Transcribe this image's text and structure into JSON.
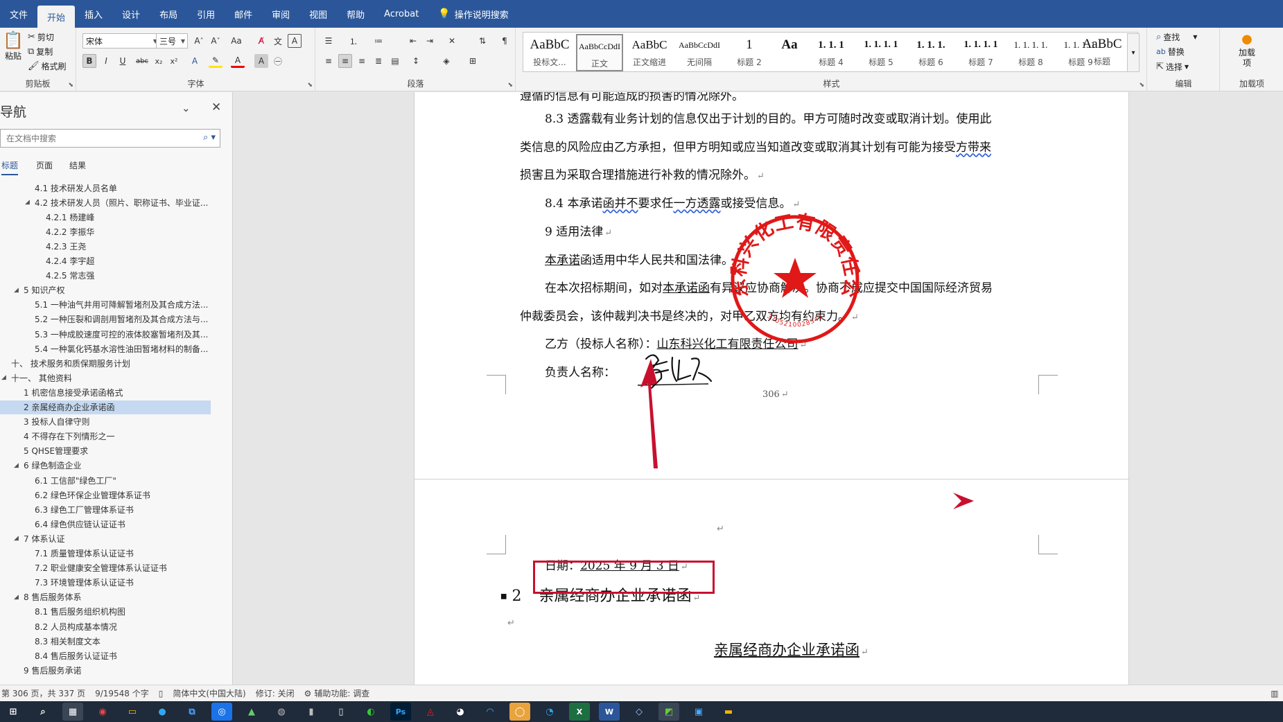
{
  "menu": {
    "tabs": [
      "文件",
      "开始",
      "插入",
      "设计",
      "布局",
      "引用",
      "邮件",
      "审阅",
      "视图",
      "帮助",
      "Acrobat"
    ],
    "active": "开始",
    "tell_me": "操作说明搜索"
  },
  "ribbon": {
    "clipboard": {
      "paste": "粘贴",
      "cut": "剪切",
      "copy": "复制",
      "format_painter": "格式刷",
      "label": "剪贴板"
    },
    "font": {
      "name": "宋体",
      "size": "三号",
      "label": "字体"
    },
    "paragraph": {
      "label": "段落"
    },
    "styles": {
      "label": "样式",
      "items": [
        {
          "preview": "AaBbC",
          "name": "投标文..."
        },
        {
          "preview": "AaBbCcDdI",
          "name": "正文"
        },
        {
          "preview": "AaBbC",
          "name": "正文缩进"
        },
        {
          "preview": "AaBbCcDdI",
          "name": "无间隔"
        },
        {
          "preview": "1",
          "name": "标题 2"
        },
        {
          "preview": "Aa",
          "name": ""
        },
        {
          "preview": "1. 1. 1",
          "name": "标题 4"
        },
        {
          "preview": "1. 1. 1. 1",
          "name": "标题 5"
        },
        {
          "preview": "1. 1. 1.",
          "name": "标题 6"
        },
        {
          "preview": "1. 1. 1. 1",
          "name": "标题 7"
        },
        {
          "preview": "1. 1. 1. 1.",
          "name": "标题 8"
        },
        {
          "preview": "1. 1. 1. 1.",
          "name": "标题 9"
        },
        {
          "preview": "AaBbC",
          "name": "标题"
        }
      ]
    },
    "editing": {
      "find": "查找",
      "replace": "替换",
      "select": "选择",
      "label": "编辑"
    },
    "addins": {
      "button": "加载项",
      "label": "加载项"
    }
  },
  "nav": {
    "title": "导航",
    "search_placeholder": "在文档中搜索",
    "tabs": [
      "标题",
      "页面",
      "结果"
    ],
    "items": [
      {
        "text": "4.1 技术研发人员名单",
        "level": 3,
        "tri": ""
      },
      {
        "text": "4.2 技术研发人员（照片、职称证书、毕业证...",
        "level": 3,
        "tri": "◢"
      },
      {
        "text": "4.2.1 杨建峰",
        "level": 4,
        "tri": ""
      },
      {
        "text": "4.2.2 李振华",
        "level": 4,
        "tri": ""
      },
      {
        "text": "4.2.3 王尧",
        "level": 4,
        "tri": ""
      },
      {
        "text": "4.2.4 李宇超",
        "level": 4,
        "tri": ""
      },
      {
        "text": "4.2.5 常志强",
        "level": 4,
        "tri": ""
      },
      {
        "text": "5 知识产权",
        "level": 2,
        "tri": "◢"
      },
      {
        "text": "5.1 一种油气井用可降解暂堵剂及其合成方法...",
        "level": 3,
        "tri": ""
      },
      {
        "text": "5.2 一种压裂和调剖用暂堵剂及其合成方法与...",
        "level": 3,
        "tri": ""
      },
      {
        "text": "5.3 一种成胶速度可控的液体胶塞暂堵剂及其...",
        "level": 3,
        "tri": ""
      },
      {
        "text": "5.4 一种氯化钙基水溶性油田暂堵材料的制备...",
        "level": 3,
        "tri": ""
      },
      {
        "text": "十、 技术服务和质保期服务计划",
        "level": 1,
        "tri": ""
      },
      {
        "text": "十一、 其他资料",
        "level": 1,
        "tri": "◢"
      },
      {
        "text": "1 机密信息接受承诺函格式",
        "level": 2,
        "tri": ""
      },
      {
        "text": "2 亲属经商办企业承诺函",
        "level": 2,
        "tri": "",
        "selected": true
      },
      {
        "text": "3 投标人自律守则",
        "level": 2,
        "tri": ""
      },
      {
        "text": "4 不得存在下列情形之一",
        "level": 2,
        "tri": ""
      },
      {
        "text": "5 QHSE管理要求",
        "level": 2,
        "tri": ""
      },
      {
        "text": "6 绿色制造企业",
        "level": 2,
        "tri": "◢"
      },
      {
        "text": "6.1 工信部\"绿色工厂\"",
        "level": 3,
        "tri": ""
      },
      {
        "text": "6.2 绿色环保企业管理体系证书",
        "level": 3,
        "tri": ""
      },
      {
        "text": "6.3 绿色工厂管理体系证书",
        "level": 3,
        "tri": ""
      },
      {
        "text": "6.4 绿色供应链认证证书",
        "level": 3,
        "tri": ""
      },
      {
        "text": "7 体系认证",
        "level": 2,
        "tri": "◢"
      },
      {
        "text": "7.1 质量管理体系认证证书",
        "level": 3,
        "tri": ""
      },
      {
        "text": "7.2 职业健康安全管理体系认证证书",
        "level": 3,
        "tri": ""
      },
      {
        "text": "7.3 环境管理体系认证证书",
        "level": 3,
        "tri": ""
      },
      {
        "text": "8 售后服务体系",
        "level": 2,
        "tri": "◢"
      },
      {
        "text": "8.1 售后服务组织机构图",
        "level": 3,
        "tri": ""
      },
      {
        "text": "8.2 人员构成基本情况",
        "level": 3,
        "tri": ""
      },
      {
        "text": "8.3 相关制度文本",
        "level": 3,
        "tri": ""
      },
      {
        "text": "8.4 售后服务认证证书",
        "level": 3,
        "tri": ""
      },
      {
        "text": "9 售后服务承诺",
        "level": 2,
        "tri": ""
      }
    ]
  },
  "document": {
    "page1": {
      "line_top": "遵循的信息有可能造成的损害的情况除外。",
      "p83a": "8.3 透露载有业务计划的信息仅出于计划的目的。甲方可随时改变或取消计划。使用此",
      "p83b_pre": "类信息的风险应由乙方承担，但甲方明知或应当知道改变或取消其计划有可能为接受",
      "p83b_wavy": "方带来",
      "p83c": "损害且为采取合理措施进行补救的情况除外。",
      "p84_a": "8.4 本承诺",
      "p84_w1": "函并不",
      "p84_b": "要求任",
      "p84_w2": "一方透露",
      "p84_c": "或接受信息。",
      "h9": "9 适用法律",
      "law_u": "本承诺",
      "law_rest": "函适用中华人民共和国法律。",
      "disp_a": "在本次招标期间，如对",
      "disp_u": "本承诺函",
      "disp_b": "有异议应协商解决。协商不成应提交中国国际经济贸易",
      "disp2": "仲裁委员会，该仲裁判决书是终决的，对甲乙双方均有约束力。",
      "party_label": "乙方（投标人名称）：",
      "party_name": "山东科兴化工有限责任公司",
      "rep_label": "负责人名称：",
      "page_no": "306"
    },
    "page2": {
      "date_label": "日期：",
      "date_value": "2025 年 9 月 3 日",
      "heading_num": "2",
      "heading_text": "亲属经商办企业承诺函",
      "title": "亲属经商办企业承诺函"
    },
    "seal": {
      "text": "山东科兴化工有限责任公司",
      "code": "3705210028342",
      "color": "#e01818"
    },
    "arrow_color": "#c8102e"
  },
  "status": {
    "page": "第 306 页，共 337 页",
    "words": "9/19548 个字",
    "lang": "简体中文(中国大陆)",
    "track": "修订: 关闭",
    "access": "辅助功能: 调查"
  }
}
